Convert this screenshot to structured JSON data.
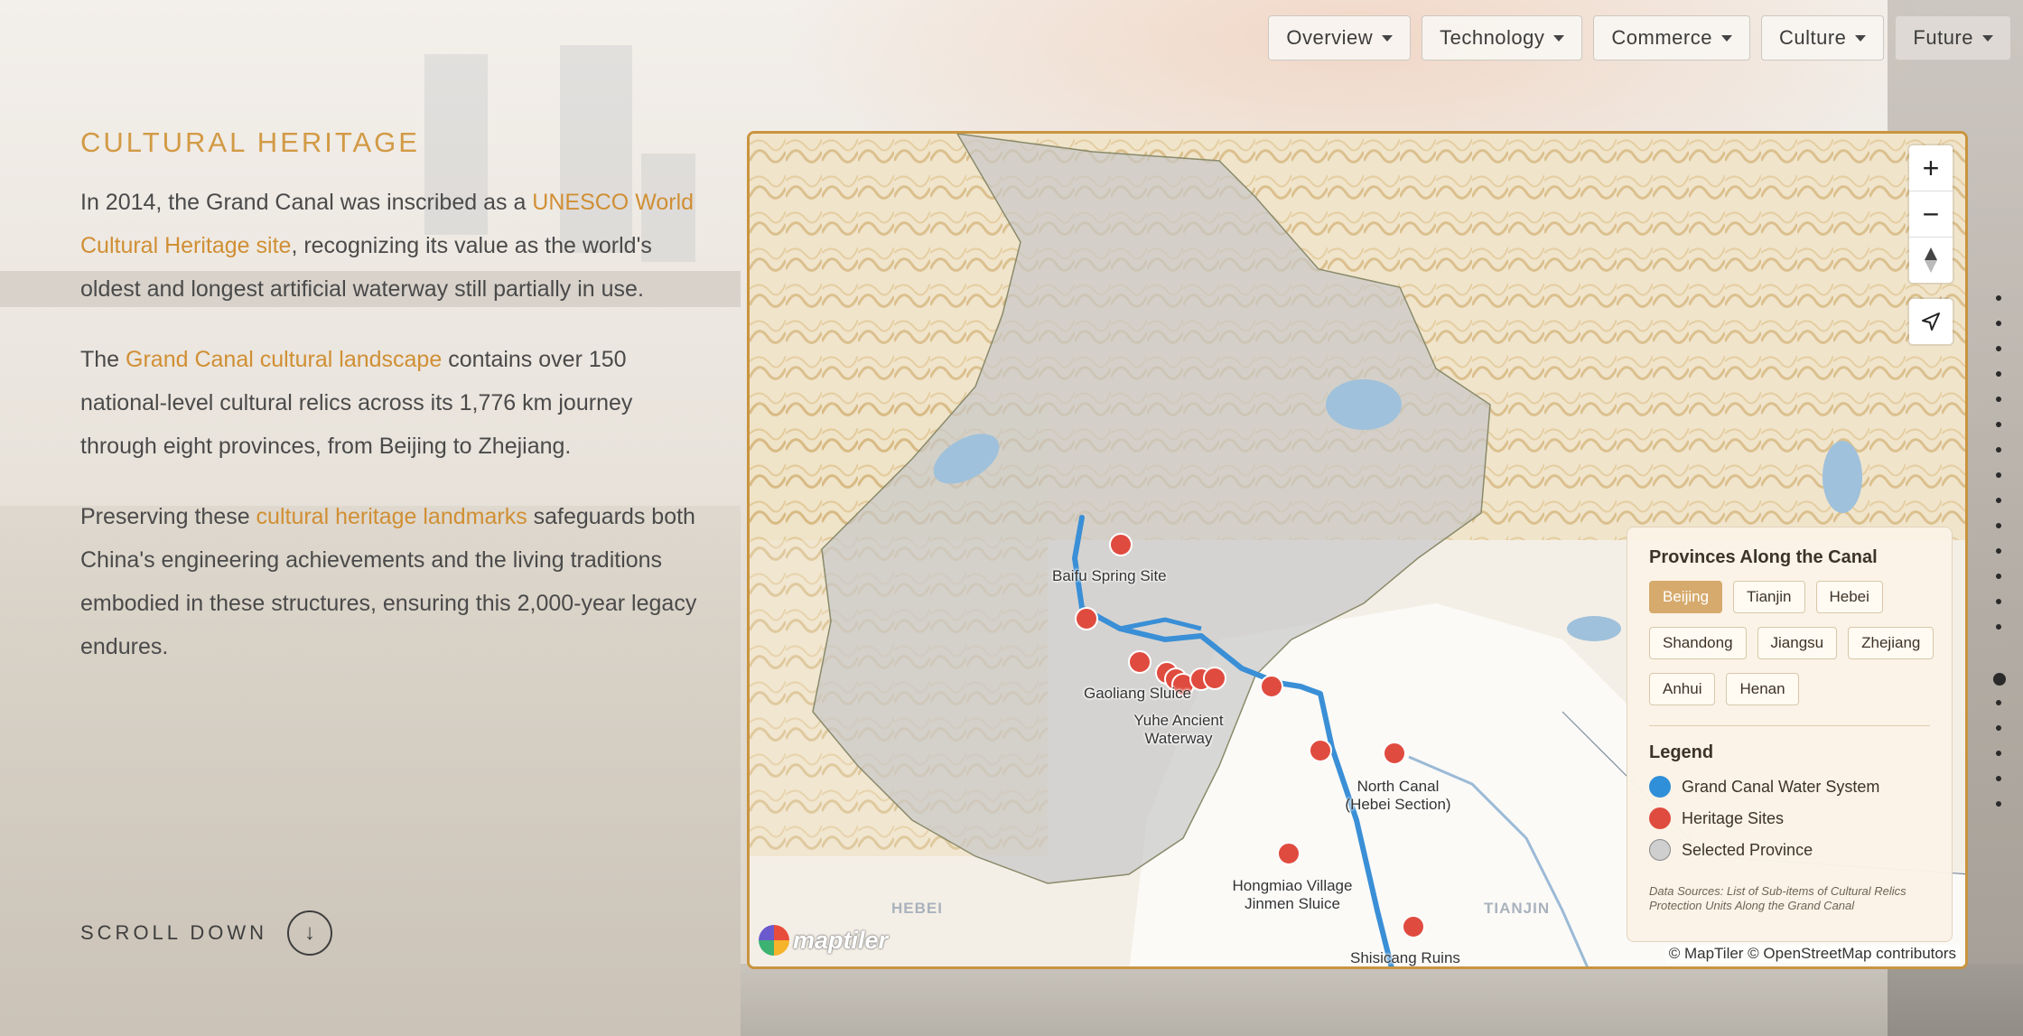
{
  "nav": {
    "items": [
      {
        "label": "Overview"
      },
      {
        "label": "Technology"
      },
      {
        "label": "Commerce"
      },
      {
        "label": "Culture"
      },
      {
        "label": "Future"
      }
    ]
  },
  "section": {
    "title": "CULTURAL HERITAGE",
    "p1": {
      "pre": "In 2014, the Grand Canal was inscribed as a ",
      "link": "UNESCO World Cultural Heritage site",
      "post": ", recognizing its value as the world's oldest and longest artificial waterway still partially in use."
    },
    "p2": {
      "pre": "The ",
      "link": "Grand Canal cultural landscape",
      "post": " contains over 150 national-level cultural relics across its 1,776 km journey through eight provinces, from Beijing to Zhejiang."
    },
    "p3": {
      "pre": "Preserving these ",
      "link": "cultural heritage landmarks",
      "post": " safeguards both China's engineering achievements and the living traditions embodied in these structures, ensuring this 2,000-year legacy endures."
    }
  },
  "scroll": {
    "label": "SCROLL DOWN",
    "icon": "↓"
  },
  "map": {
    "labels": {
      "baifu": "Baifu Spring Site",
      "gaoliang": "Gaoliang Sluice",
      "yuhe": "Yuhe Ancient Waterway",
      "north_canal": "North Canal (Hebei Section)",
      "hongmiao": "Hongmiao Village Jinmen Sluice",
      "shisicang": "Shisicang Ruins"
    },
    "regions": {
      "hebei": "HEBEI",
      "tianjin": "TIANJIN"
    },
    "controls": {
      "zoom_in": "+",
      "zoom_out": "−"
    },
    "logo_text": "maptiler",
    "attribution": "© MapTiler © OpenStreetMap contributors"
  },
  "panel": {
    "provinces_title": "Provinces Along the Canal",
    "provinces": [
      "Beijing",
      "Tianjin",
      "Hebei",
      "Shandong",
      "Jiangsu",
      "Zhejiang",
      "Anhui",
      "Henan"
    ],
    "selected": "Beijing",
    "legend_title": "Legend",
    "legend": [
      {
        "label": "Grand Canal Water System",
        "color": "#2f8fd8"
      },
      {
        "label": "Heritage Sites",
        "color": "#e04b3f"
      },
      {
        "label": "Selected Province",
        "color": "#cfcfcf"
      }
    ],
    "sources": "Data Sources: List of Sub-items of Cultural Relics Protection Units Along the Grand Canal"
  },
  "colors": {
    "accent": "#d29a45",
    "canal": "#3a8fd6",
    "site": "#e04b3f",
    "frame": "#c9943f"
  }
}
